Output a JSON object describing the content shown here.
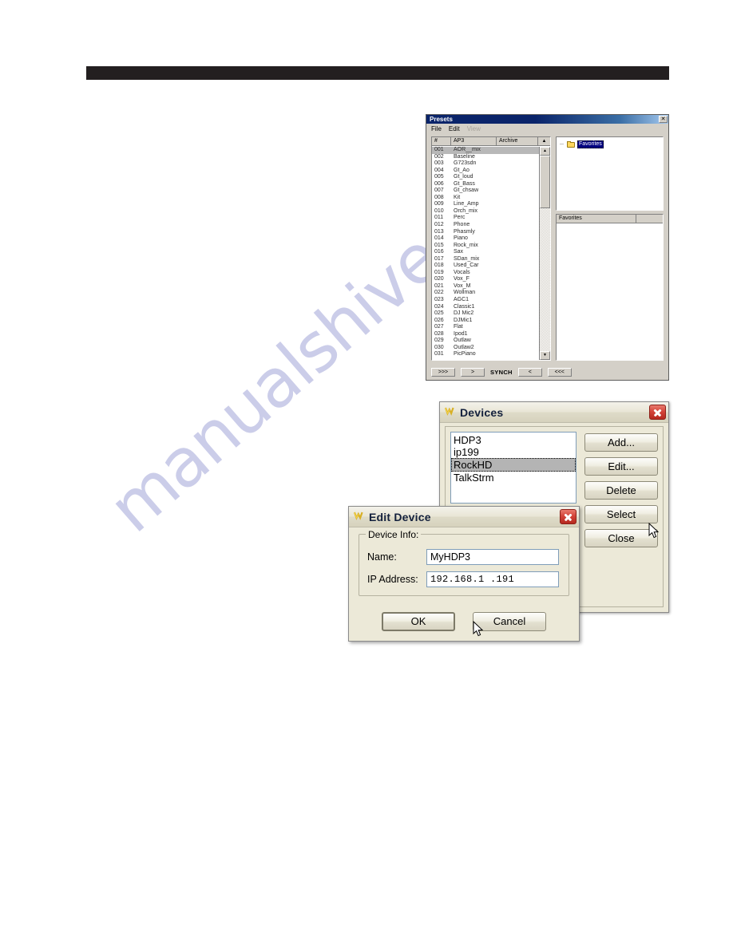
{
  "watermark": {
    "text": "manualshive.com",
    "color": "#c9cbe8"
  },
  "presets_window": {
    "title": "Presets",
    "close_label": "✕",
    "menus": [
      {
        "label": "File",
        "disabled": false
      },
      {
        "label": "Edit",
        "disabled": false
      },
      {
        "label": "View",
        "disabled": true
      }
    ],
    "columns": [
      "#",
      "AP3",
      "Archive"
    ],
    "sort_icon": "▲",
    "rows": [
      {
        "num": "001",
        "name": "AOR__mix",
        "selected": true
      },
      {
        "num": "002",
        "name": "Baseline",
        "selected": false
      },
      {
        "num": "003",
        "name": "G723sdn",
        "selected": false
      },
      {
        "num": "004",
        "name": "Gt_Ao",
        "selected": false
      },
      {
        "num": "005",
        "name": "Gt_loud",
        "selected": false
      },
      {
        "num": "006",
        "name": "Gt_Bass",
        "selected": false
      },
      {
        "num": "007",
        "name": "Gt_chsaw",
        "selected": false
      },
      {
        "num": "008",
        "name": "Kit",
        "selected": false
      },
      {
        "num": "009",
        "name": "Line_Amp",
        "selected": false
      },
      {
        "num": "010",
        "name": "Orch_mix",
        "selected": false
      },
      {
        "num": "011",
        "name": "Perc",
        "selected": false
      },
      {
        "num": "012",
        "name": "Phone",
        "selected": false
      },
      {
        "num": "013",
        "name": "Phasmly",
        "selected": false
      },
      {
        "num": "014",
        "name": "Piano",
        "selected": false
      },
      {
        "num": "015",
        "name": "Rock_mix",
        "selected": false
      },
      {
        "num": "016",
        "name": "Sax",
        "selected": false
      },
      {
        "num": "017",
        "name": "SDan_mix",
        "selected": false
      },
      {
        "num": "018",
        "name": "Used_Car",
        "selected": false
      },
      {
        "num": "019",
        "name": "Vocals",
        "selected": false
      },
      {
        "num": "020",
        "name": "Vox_F",
        "selected": false
      },
      {
        "num": "021",
        "name": "Vox_M",
        "selected": false
      },
      {
        "num": "022",
        "name": "Wollman",
        "selected": false
      },
      {
        "num": "023",
        "name": "AGC1",
        "selected": false
      },
      {
        "num": "024",
        "name": "Classic1",
        "selected": false
      },
      {
        "num": "025",
        "name": "DJ Mic2",
        "selected": false
      },
      {
        "num": "026",
        "name": "DJMic1",
        "selected": false
      },
      {
        "num": "027",
        "name": "Flat",
        "selected": false
      },
      {
        "num": "028",
        "name": "Ipod1",
        "selected": false
      },
      {
        "num": "029",
        "name": "Outlaw",
        "selected": false
      },
      {
        "num": "030",
        "name": "Outlaw2",
        "selected": false
      },
      {
        "num": "031",
        "name": "PicPiano",
        "selected": false
      }
    ],
    "tree": {
      "node_label": "Favorites"
    },
    "favorites_columns": [
      "Favorites",
      ""
    ],
    "footer": {
      "send_all": ">>>",
      "send_one": ">",
      "synch": "SYNCH",
      "get_one": "<",
      "get_all": "<<<"
    }
  },
  "devices_dialog": {
    "title": "Devices",
    "devices": [
      {
        "name": "HDP3",
        "selected": false
      },
      {
        "name": "ip199",
        "selected": false
      },
      {
        "name": "RockHD",
        "selected": true
      },
      {
        "name": "TalkStrm",
        "selected": false
      }
    ],
    "buttons": [
      {
        "label": "Add..."
      },
      {
        "label": "Edit..."
      },
      {
        "label": "Delete"
      },
      {
        "label": "Select"
      },
      {
        "label": "Close"
      }
    ]
  },
  "edit_device_dialog": {
    "title": "Edit Device",
    "group_title": "Device Info:",
    "fields": [
      {
        "label": "Name:",
        "value": "MyHDP3"
      },
      {
        "label": "IP Address:",
        "value": "192.168.1  .191"
      }
    ],
    "ok_label": "OK",
    "cancel_label": "Cancel"
  }
}
